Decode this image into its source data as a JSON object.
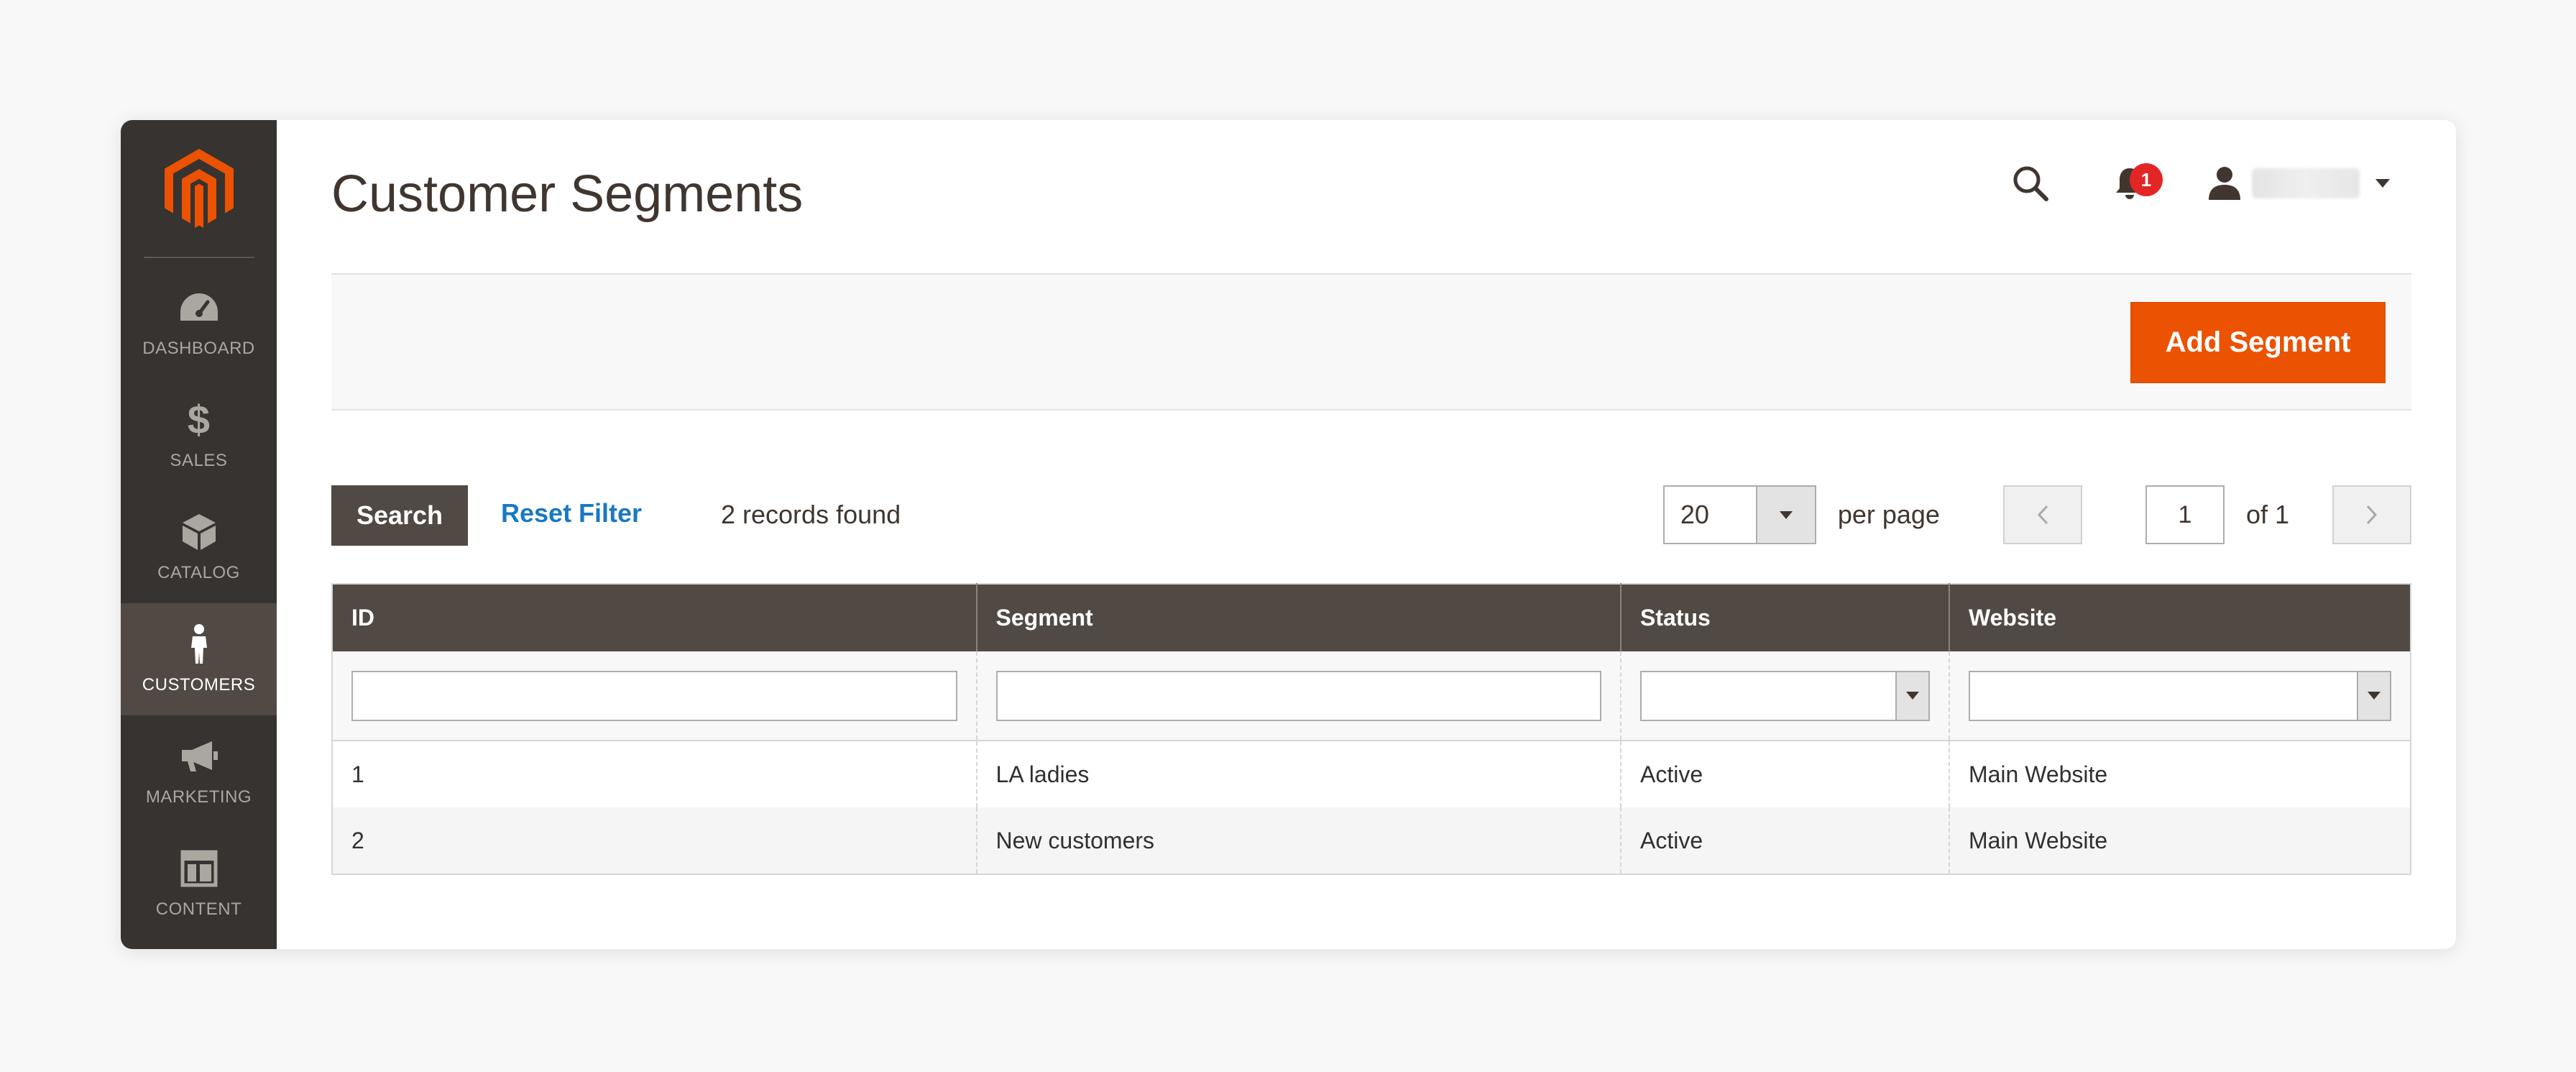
{
  "sidebar": {
    "items": [
      {
        "label": "DASHBOARD",
        "icon": "dashboard-gauge-icon",
        "active": false
      },
      {
        "label": "SALES",
        "icon": "dollar-icon",
        "active": false
      },
      {
        "label": "CATALOG",
        "icon": "box-icon",
        "active": false
      },
      {
        "label": "CUSTOMERS",
        "icon": "person-icon",
        "active": true
      },
      {
        "label": "MARKETING",
        "icon": "megaphone-icon",
        "active": false
      },
      {
        "label": "CONTENT",
        "icon": "layout-icon",
        "active": false
      }
    ],
    "dollar_glyph": "$"
  },
  "header": {
    "title": "Customer Segments",
    "notification_count": "1"
  },
  "actions": {
    "add_segment_label": "Add Segment"
  },
  "grid": {
    "search_label": "Search",
    "reset_filter_label": "Reset Filter",
    "records_found": "2 records found",
    "per_page_value": "20",
    "per_page_label": "per page",
    "current_page": "1",
    "of_pages": "of 1",
    "columns": [
      "ID",
      "Segment",
      "Status",
      "Website"
    ],
    "rows": [
      {
        "id": "1",
        "segment": "LA ladies",
        "status": "Active",
        "website": "Main Website"
      },
      {
        "id": "2",
        "segment": "New customers",
        "status": "Active",
        "website": "Main Website"
      }
    ]
  },
  "colors": {
    "sidebar_bg": "#373330",
    "sidebar_active_bg": "#514943",
    "accent_orange": "#eb5202",
    "table_header_bg": "#514943",
    "link_blue": "#1979c3",
    "badge_red": "#e22626"
  }
}
